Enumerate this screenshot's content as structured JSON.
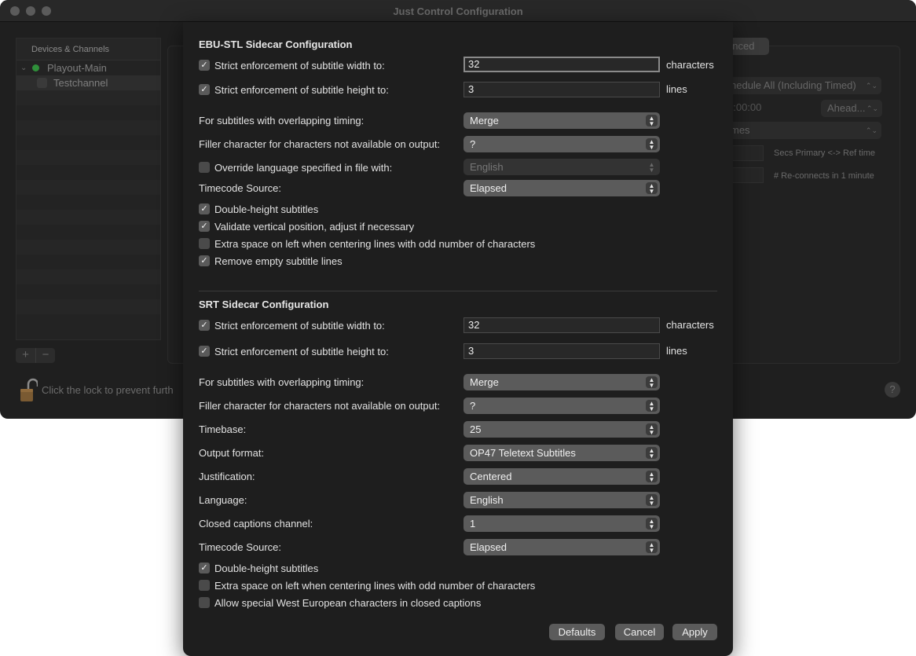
{
  "window": {
    "title": "Just Control Configuration"
  },
  "devices": {
    "header": "Devices & Channels",
    "device": "Playout-Main",
    "channel": "Testchannel"
  },
  "lock_text": "Click the lock to prevent furth",
  "background_panel": {
    "tab_partial": "anced",
    "schedule_popup": "hedule All (Including Timed)",
    "time_field": "0:00:00",
    "ahead_popup": "Ahead...",
    "frames_popup": "mes",
    "secs_label": "Secs Primary <-> Ref time",
    "reconnects_label": "# Re-connects in 1 minute",
    "help": "?"
  },
  "ebu": {
    "title": "EBU-STL Sidecar Configuration",
    "width_label": "Strict enforcement of subtitle width to:",
    "width_value": "32",
    "width_unit": "characters",
    "height_label": "Strict enforcement of subtitle height to:",
    "height_value": "3",
    "height_unit": "lines",
    "overlap_label": "For subtitles with overlapping timing:",
    "overlap_value": "Merge",
    "filler_label": "Filler character for characters not available on output:",
    "filler_value": "?",
    "override_label": "Override language specified in file with:",
    "override_value": "English",
    "tc_label": "Timecode Source:",
    "tc_value": "Elapsed",
    "double_height": "Double-height subtitles",
    "validate": "Validate vertical position, adjust if necessary",
    "extra_space": "Extra space on left when centering lines with odd number of characters",
    "remove_empty": "Remove empty subtitle lines"
  },
  "srt": {
    "title": "SRT Sidecar Configuration",
    "width_label": "Strict enforcement of subtitle width to:",
    "width_value": "32",
    "width_unit": "characters",
    "height_label": "Strict enforcement of subtitle height to:",
    "height_value": "3",
    "height_unit": "lines",
    "overlap_label": "For subtitles with overlapping timing:",
    "overlap_value": "Merge",
    "filler_label": "Filler character for characters not available on output:",
    "filler_value": "?",
    "timebase_label": "Timebase:",
    "timebase_value": "25",
    "output_label": "Output format:",
    "output_value": "OP47 Teletext Subtitles",
    "just_label": "Justification:",
    "just_value": "Centered",
    "lang_label": "Language:",
    "lang_value": "English",
    "cc_label": "Closed captions channel:",
    "cc_value": "1",
    "tc_label": "Timecode Source:",
    "tc_value": "Elapsed",
    "double_height": "Double-height subtitles",
    "extra_space": "Extra space on left when centering lines with odd number of characters",
    "west_european": "Allow special West European characters in closed captions"
  },
  "buttons": {
    "defaults": "Defaults",
    "cancel": "Cancel",
    "apply": "Apply"
  },
  "glyphs": {
    "check": "✓",
    "popup_arrows": "⌃⌄",
    "plus": "+",
    "minus": "−",
    "chevron": "⌄"
  },
  "colors": {
    "device_status": "#2f8f3a",
    "sheet_bg": "#1e1e1e",
    "popup_bg": "#5b5b5b"
  }
}
